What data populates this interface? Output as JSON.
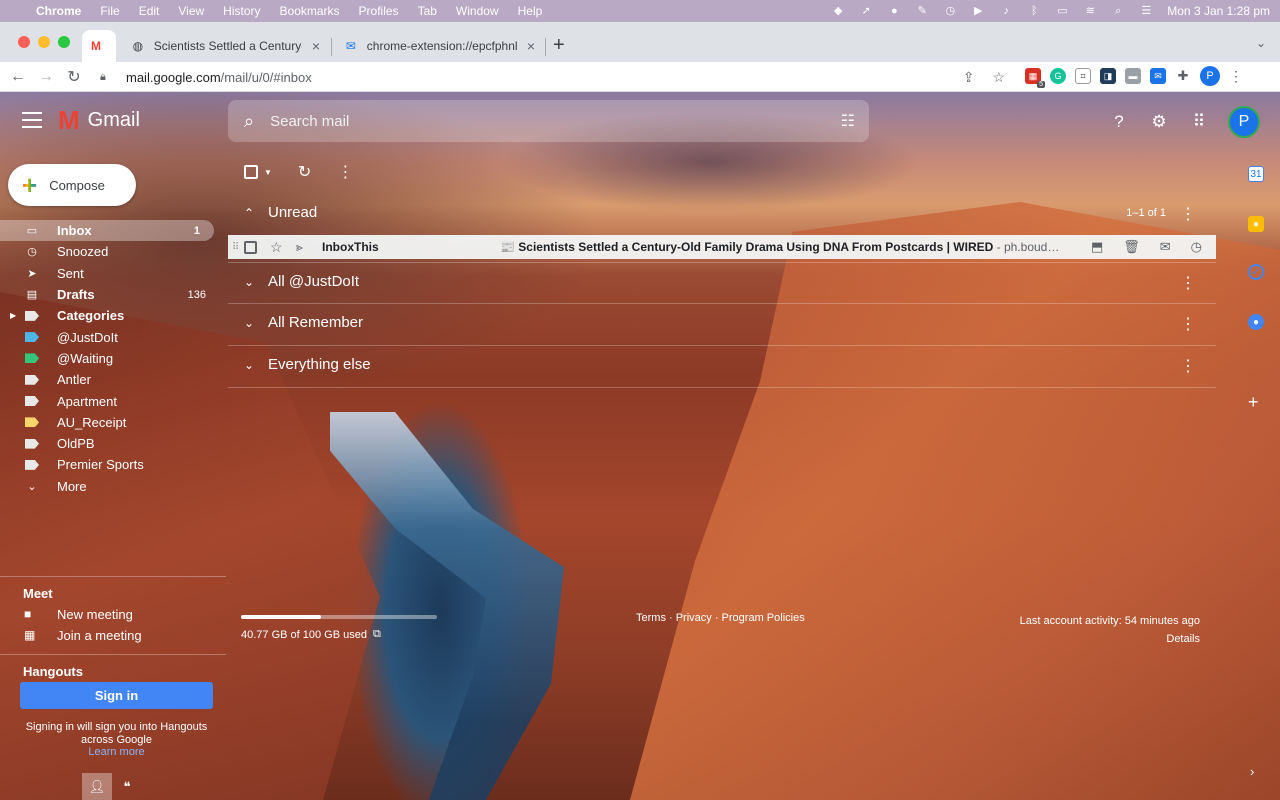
{
  "menubar": {
    "app": "Chrome",
    "items": [
      "File",
      "Edit",
      "View",
      "History",
      "Bookmarks",
      "Profiles",
      "Tab",
      "Window",
      "Help"
    ],
    "clock": "Mon 3 Jan  1:28 pm"
  },
  "browser": {
    "tabs": [
      {
        "title": "Scientists Settled a Century-Ol"
      },
      {
        "title": "chrome-extension://epcfphnlbr"
      }
    ],
    "url_host": "mail.google.com",
    "url_path": "/mail/u/0/#inbox",
    "ext_badge": "5",
    "profile_initial": "P"
  },
  "gmail": {
    "logo_text": "Gmail",
    "search_placeholder": "Search mail",
    "avatar_initial": "P",
    "compose_label": "Compose",
    "nav": [
      {
        "label": "Inbox",
        "count": "1"
      },
      {
        "label": "Snoozed",
        "count": ""
      },
      {
        "label": "Sent",
        "count": ""
      },
      {
        "label": "Drafts",
        "count": "136"
      },
      {
        "label": "Categories",
        "count": ""
      },
      {
        "label": "@JustDoIt",
        "count": ""
      },
      {
        "label": "@Waiting",
        "count": ""
      },
      {
        "label": "Antler",
        "count": ""
      },
      {
        "label": "Apartment",
        "count": ""
      },
      {
        "label": "AU_Receipt",
        "count": ""
      },
      {
        "label": "OldPB",
        "count": ""
      },
      {
        "label": "Premier Sports",
        "count": ""
      },
      {
        "label": "More",
        "count": ""
      }
    ],
    "label_colors": {
      "justdoit": "#4db6e6",
      "waiting": "#34c77b",
      "au_receipt": "#f6d66a",
      "default": "#e8e8e8"
    },
    "meet": {
      "title": "Meet",
      "new_meeting": "New meeting",
      "join_meeting": "Join a meeting"
    },
    "hangouts": {
      "title": "Hangouts",
      "signin": "Sign in",
      "note": "Signing in will sign you into Hangouts across Google",
      "learn_more": "Learn more"
    },
    "sections": [
      {
        "name": "Unread",
        "range": "1–1 of 1"
      },
      {
        "name": "All @JustDoIt",
        "range": ""
      },
      {
        "name": "All Remember",
        "range": ""
      },
      {
        "name": "Everything else",
        "range": ""
      }
    ],
    "message": {
      "sender": "InboxThis",
      "subject": "📰 Scientists Settled a Century-Old Family Drama Using DNA From Postcards | WIRED",
      "snippet": " - ph.boud…"
    },
    "storage": {
      "text": "40.77 GB of 100 GB used",
      "fraction": 0.41
    },
    "footer": {
      "links": "Terms · Privacy · Program Policies",
      "activity": "Last account activity: 54 minutes ago",
      "details": "Details"
    }
  }
}
